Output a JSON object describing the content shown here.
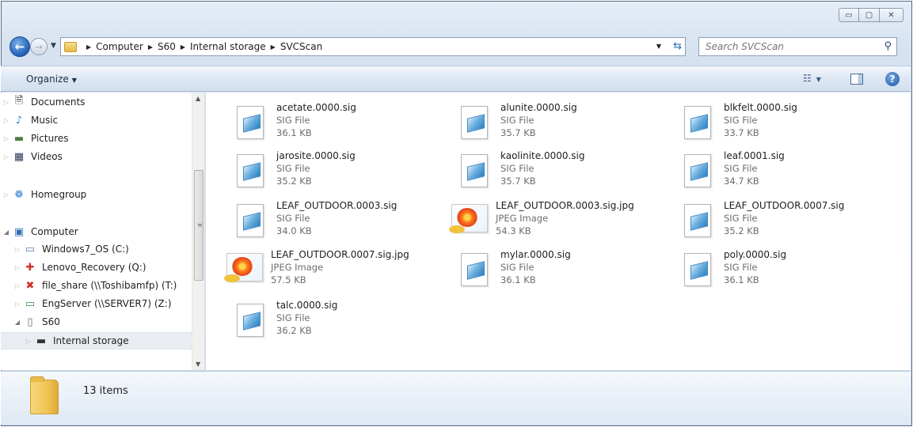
{
  "window": {
    "caption_buttons": [
      "minimize-icon",
      "maximize-icon",
      "close-icon"
    ]
  },
  "address": {
    "breadcrumbs": [
      "Computer",
      "S60",
      "Internal storage",
      "SVCScan"
    ]
  },
  "search": {
    "placeholder": "Search SVCScan"
  },
  "toolbar": {
    "organize_label": "Organize"
  },
  "nav": {
    "items": [
      {
        "label": "Documents",
        "icon": "documents-icon"
      },
      {
        "label": "Music",
        "icon": "music-icon"
      },
      {
        "label": "Pictures",
        "icon": "pictures-icon"
      },
      {
        "label": "Videos",
        "icon": "videos-icon"
      },
      {
        "label": "Homegroup",
        "icon": "homegroup-icon"
      },
      {
        "label": "Computer",
        "icon": "computer-icon"
      },
      {
        "label": "Windows7_OS (C:)",
        "icon": "drive-icon"
      },
      {
        "label": "Lenovo_Recovery (Q:)",
        "icon": "recovery-drive-icon"
      },
      {
        "label": "file_share (\\\\Toshibamfp) (T:)",
        "icon": "disconnected-network-drive-icon"
      },
      {
        "label": "EngServer (\\\\SERVER7) (Z:)",
        "icon": "network-drive-icon"
      },
      {
        "label": "S60",
        "icon": "phone-icon"
      },
      {
        "label": "Internal storage",
        "icon": "storage-icon"
      }
    ]
  },
  "files": [
    {
      "name": "acetate.0000.sig",
      "type": "SIG File",
      "size": "36.1 KB"
    },
    {
      "name": "alunite.0000.sig",
      "type": "SIG File",
      "size": "35.7 KB"
    },
    {
      "name": "blkfelt.0000.sig",
      "type": "SIG File",
      "size": "33.7 KB"
    },
    {
      "name": "jarosite.0000.sig",
      "type": "SIG File",
      "size": "35.2 KB"
    },
    {
      "name": "kaolinite.0000.sig",
      "type": "SIG File",
      "size": "35.7 KB"
    },
    {
      "name": "leaf.0001.sig",
      "type": "SIG File",
      "size": "34.7 KB"
    },
    {
      "name": "LEAF_OUTDOOR.0003.sig",
      "type": "SIG File",
      "size": "34.0 KB"
    },
    {
      "name": "LEAF_OUTDOOR.0003.sig.jpg",
      "type": "JPEG Image",
      "size": "54.3 KB"
    },
    {
      "name": "LEAF_OUTDOOR.0007.sig",
      "type": "SIG File",
      "size": "35.2 KB"
    },
    {
      "name": "LEAF_OUTDOOR.0007.sig.jpg",
      "type": "JPEG Image",
      "size": "57.5 KB"
    },
    {
      "name": "mylar.0000.sig",
      "type": "SIG File",
      "size": "36.1 KB"
    },
    {
      "name": "poly.0000.sig",
      "type": "SIG File",
      "size": "36.1 KB"
    },
    {
      "name": "talc.0000.sig",
      "type": "SIG File",
      "size": "36.2 KB"
    }
  ],
  "details": {
    "item_count": "13 items"
  }
}
